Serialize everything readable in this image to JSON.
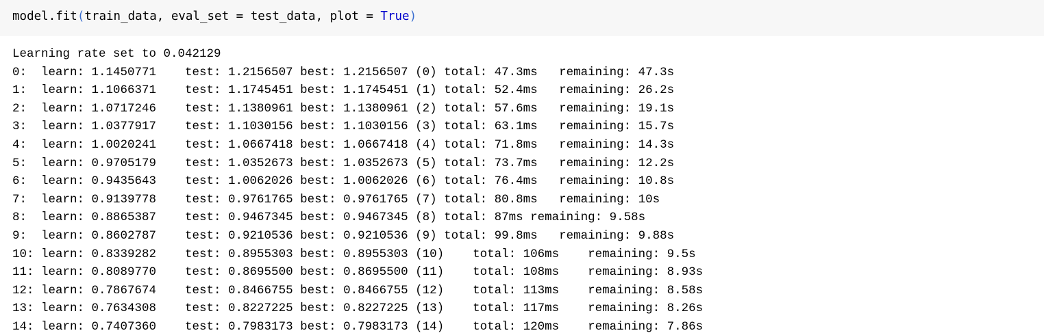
{
  "code_cell": {
    "object": "model",
    "method": ".fit",
    "open_paren": "(",
    "arg1": "train_data",
    "comma1": ", ",
    "kw_eval": "eval_set",
    "assign1": " = ",
    "arg2": "test_data",
    "comma2": ", ",
    "kw_plot": "plot",
    "assign2": " = ",
    "bool_true": "True",
    "close_paren": ")"
  },
  "output": {
    "lines": [
      "Learning rate set to 0.042129",
      "0:  learn: 1.1450771    test: 1.2156507 best: 1.2156507 (0) total: 47.3ms   remaining: 47.3s",
      "1:  learn: 1.1066371    test: 1.1745451 best: 1.1745451 (1) total: 52.4ms   remaining: 26.2s",
      "2:  learn: 1.0717246    test: 1.1380961 best: 1.1380961 (2) total: 57.6ms   remaining: 19.1s",
      "3:  learn: 1.0377917    test: 1.1030156 best: 1.1030156 (3) total: 63.1ms   remaining: 15.7s",
      "4:  learn: 1.0020241    test: 1.0667418 best: 1.0667418 (4) total: 71.8ms   remaining: 14.3s",
      "5:  learn: 0.9705179    test: 1.0352673 best: 1.0352673 (5) total: 73.7ms   remaining: 12.2s",
      "6:  learn: 0.9435643    test: 1.0062026 best: 1.0062026 (6) total: 76.4ms   remaining: 10.8s",
      "7:  learn: 0.9139778    test: 0.9761765 best: 0.9761765 (7) total: 80.8ms   remaining: 10s",
      "8:  learn: 0.8865387    test: 0.9467345 best: 0.9467345 (8) total: 87ms remaining: 9.58s",
      "9:  learn: 0.8602787    test: 0.9210536 best: 0.9210536 (9) total: 99.8ms   remaining: 9.88s",
      "10: learn: 0.8339282    test: 0.8955303 best: 0.8955303 (10)    total: 106ms    remaining: 9.5s",
      "11: learn: 0.8089770    test: 0.8695500 best: 0.8695500 (11)    total: 108ms    remaining: 8.93s",
      "12: learn: 0.7867674    test: 0.8466755 best: 0.8466755 (12)    total: 113ms    remaining: 8.58s",
      "13: learn: 0.7634308    test: 0.8227225 best: 0.8227225 (13)    total: 117ms    remaining: 8.26s",
      "14: learn: 0.7407360    test: 0.7983173 best: 0.7983173 (14)    total: 120ms    remaining: 7.86s"
    ]
  }
}
